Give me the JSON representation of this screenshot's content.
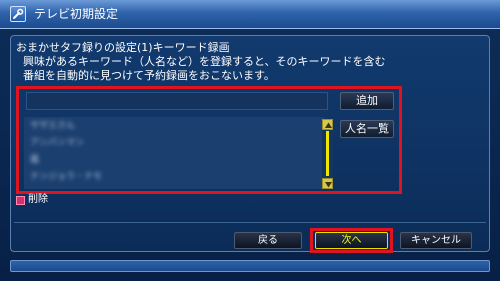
{
  "window": {
    "title": "テレビ初期設定",
    "title_icon": "wrench-icon"
  },
  "description": {
    "line1": "おまかせタフ録りの設定(1)キーワード録画",
    "line2": "興味があるキーワード（人名など）を登録すると、そのキーワードを含む",
    "line3": "番組を自動的に見つけて予約録画をおこないます。"
  },
  "keyword_input": {
    "value": ""
  },
  "keyword_list": {
    "items": [
      "サザエさん",
      "アンパンマン",
      "嵐",
      "ナンジョラ・ナモ"
    ]
  },
  "side_buttons": {
    "add_label": "追加",
    "names_label": "人名一覧"
  },
  "delete": {
    "label": "削除",
    "color": "#d6316f"
  },
  "bottom_buttons": {
    "back_label": "戻る",
    "next_label": "次へ",
    "cancel_label": "キャンセル"
  },
  "colors": {
    "highlight": "#e0141e",
    "focus_text": "#ffff00",
    "scrollbar": "#f0e600"
  }
}
